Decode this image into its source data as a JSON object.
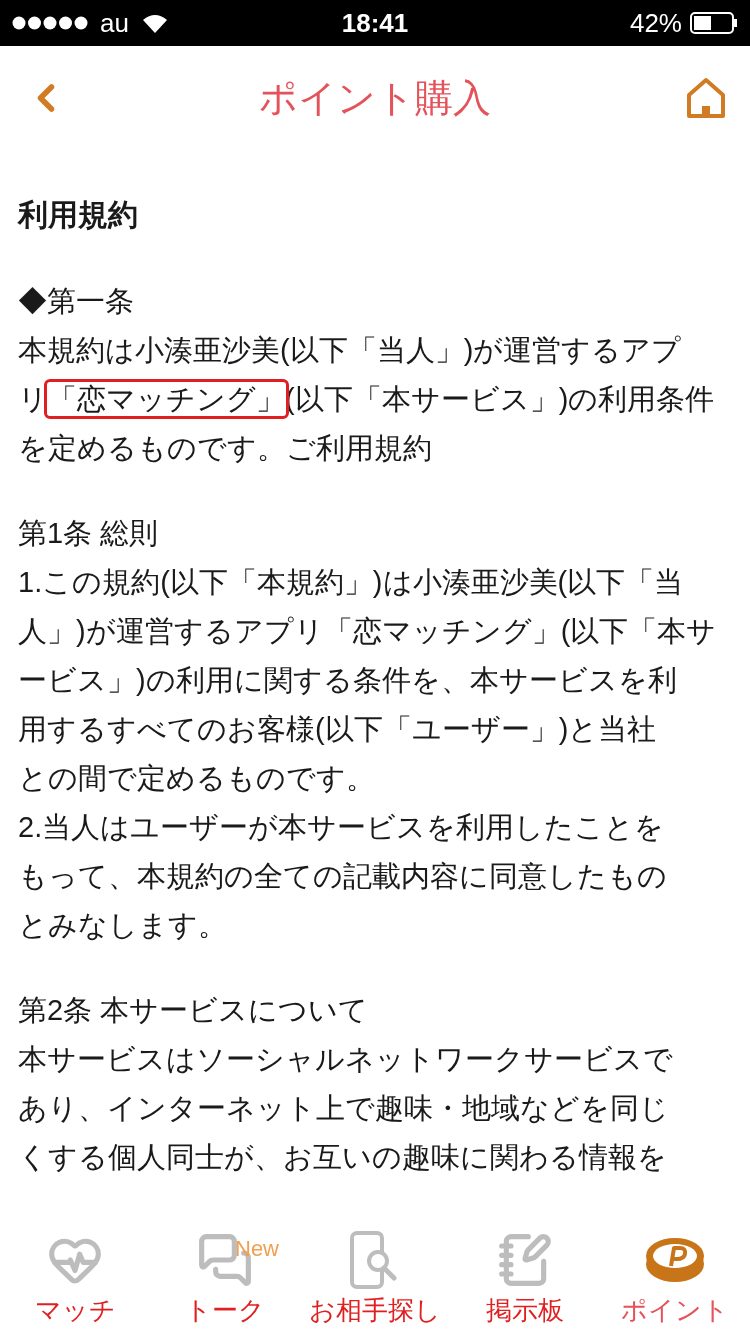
{
  "status_bar": {
    "carrier": "au",
    "time": "18:41",
    "battery": "42%"
  },
  "header": {
    "title": "ポイント購入"
  },
  "content": {
    "title": "利用規約",
    "paragraphs": [
      {
        "lines": [
          "◆第一条",
          "本規約は小湊亜沙美(以下「当人」)が運営するアプ",
          [
            {
              "text": "リ",
              "highlighted": false
            },
            {
              "text": "「恋マッチング」",
              "highlighted": true
            },
            {
              "text": "(以下「本サービス」)の利用条件",
              "highlighted": false
            }
          ],
          "を定めるものです。ご利用規約"
        ]
      },
      {
        "lines": [
          "第1条 総則",
          "1.この規約(以下「本規約」)は小湊亜沙美(以下「当",
          "人」)が運営するアプリ「恋マッチング」(以下「本サ",
          "ービス」)の利用に関する条件を、本サービスを利",
          "用するすべてのお客様(以下「ユーザー」)と当社",
          "との間で定めるものです。",
          "2.当人はユーザーが本サービスを利用したことを",
          "もって、本規約の全ての記載内容に同意したもの",
          "とみなします。"
        ]
      },
      {
        "lines": [
          "第2条 本サービスについて",
          "本サービスはソーシャルネットワークサービスで",
          "あり、インターネット上で趣味・地域などを同じ",
          "くする個人同士が、お互いの趣味に関わる情報を"
        ]
      }
    ]
  },
  "tab_bar": [
    {
      "kind": "match",
      "label": "マッチ",
      "selected": false
    },
    {
      "kind": "talk",
      "label": "トーク",
      "selected": false,
      "badge": "New"
    },
    {
      "kind": "search",
      "label": "お相手探し",
      "selected": false
    },
    {
      "kind": "board",
      "label": "掲示板",
      "selected": false
    },
    {
      "kind": "point",
      "label": "ポイント",
      "selected": true
    }
  ]
}
